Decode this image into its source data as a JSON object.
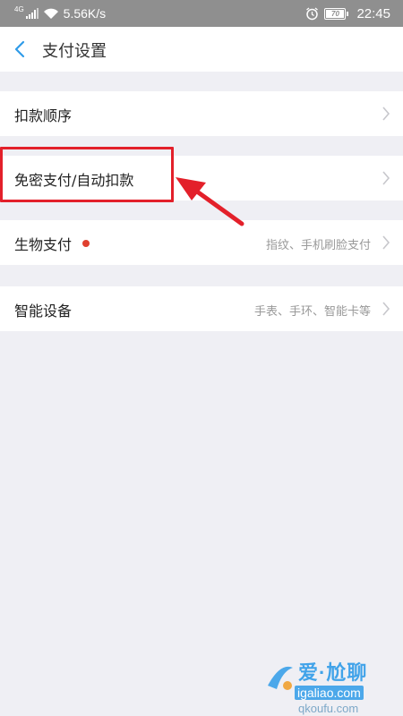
{
  "status_bar": {
    "network": "4G",
    "speed": "5.56K/s",
    "battery": "70",
    "time": "22:45"
  },
  "header": {
    "title": "支付设置"
  },
  "rows": [
    {
      "label": "扣款顺序",
      "value": ""
    },
    {
      "label": "免密支付/自动扣款",
      "value": ""
    },
    {
      "label": "生物支付",
      "value": "指纹、手机刷脸支付",
      "badge": "red-dot"
    },
    {
      "label": "智能设备",
      "value": "手表、手环、智能卡等"
    }
  ],
  "watermark": {
    "brand": "爱·尬聊",
    "url": "igaliao.com",
    "sub": "qkoufu.com"
  },
  "colors": {
    "accent": "#2f9be8",
    "annotation": "#e3202a",
    "badge": "#e0402f",
    "background": "#efeff4"
  }
}
